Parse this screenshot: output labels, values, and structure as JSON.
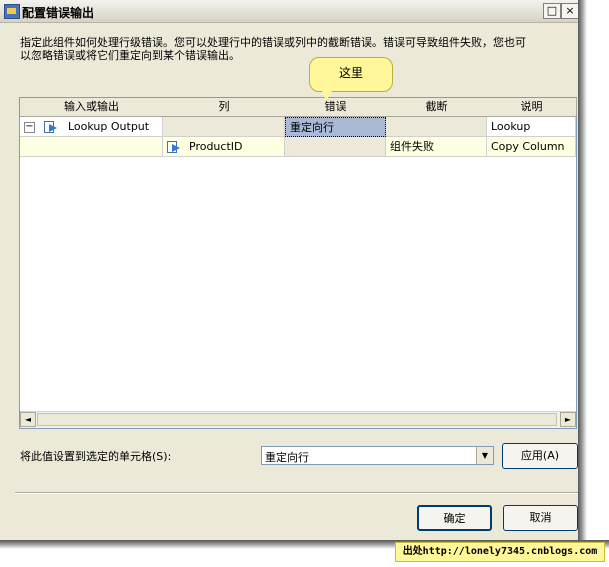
{
  "window": {
    "title": "配置错误输出"
  },
  "description": {
    "line1": "指定此组件如何处理行级错误。您可以处理行中的错误或列中的截断错误。错误可导致组件失败，您也可",
    "line2": "以忽略错误或将它们重定向到某个错误输出。"
  },
  "callout": "这里",
  "grid": {
    "headers": [
      "输入或输出",
      "列",
      "错误",
      "截断",
      "说明"
    ],
    "rows": [
      {
        "input_output": "Lookup Output",
        "column": "",
        "error": "重定向行",
        "truncation": "",
        "description": "Lookup"
      },
      {
        "input_output": "",
        "column": "ProductID",
        "error": "",
        "truncation": "组件失败",
        "description": "Copy Column"
      }
    ],
    "expander": "−"
  },
  "scroll": {
    "left": "◄",
    "right": "►"
  },
  "set_value": {
    "label": "将此值设置到选定的单元格(S):",
    "value": "重定向行",
    "dropdown": "▼",
    "apply_label": "应用(A)"
  },
  "buttons": {
    "ok": "确定",
    "cancel": "取消"
  },
  "titlebar_buttons": {
    "maximize": "□",
    "close": "×"
  },
  "watermark": "出处http://lonely7345.cnblogs.com"
}
